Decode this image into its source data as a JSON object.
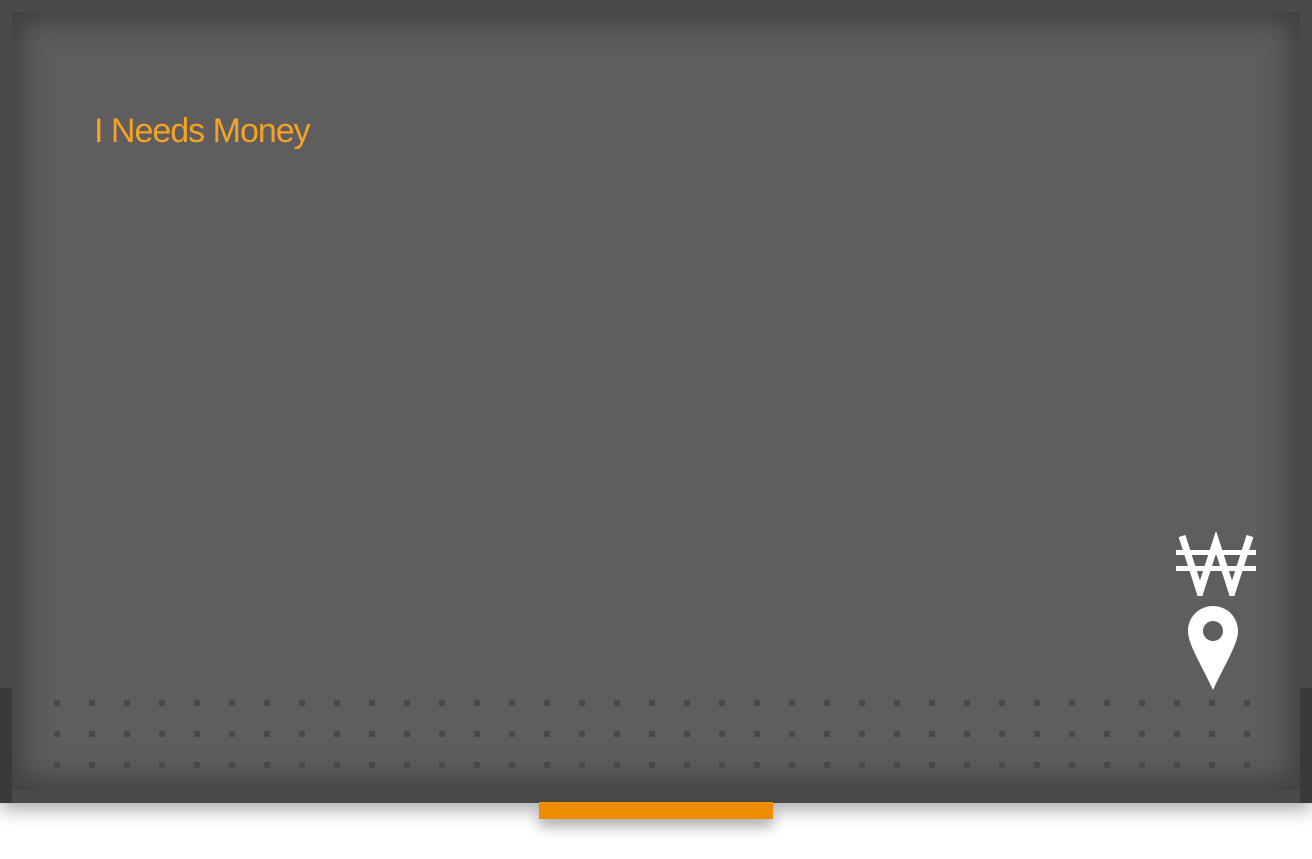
{
  "app": {
    "title": "I Needs Money"
  },
  "icons": {
    "currency": "won-sign-icon",
    "location": "map-pin-icon"
  },
  "colors": {
    "accent": "#f5a325",
    "tab": "#f08c00",
    "screen_background": "#5f5d5e",
    "frame": "#4a4a4a",
    "icon": "#ffffff"
  }
}
